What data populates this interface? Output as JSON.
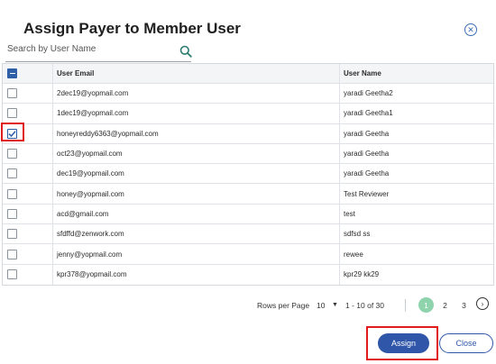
{
  "dialog": {
    "title": "Assign Payer to Member User",
    "close_icon": "close-circle-icon"
  },
  "search": {
    "placeholder": "Search by User Name",
    "icon": "search-icon"
  },
  "table": {
    "columns": [
      "User Email",
      "User Name"
    ],
    "rows": [
      {
        "email": "2dec19@yopmail.com",
        "name": "yaradi Geetha2",
        "checked": false
      },
      {
        "email": "1dec19@yopmail.com",
        "name": "yaradi Geetha1",
        "checked": false
      },
      {
        "email": "honeyreddy6363@yopmail.com",
        "name": "yaradi Geetha",
        "checked": true
      },
      {
        "email": "oct23@yopmail.com",
        "name": "yaradi Geetha",
        "checked": false
      },
      {
        "email": "dec19@yopmail.com",
        "name": "yaradi Geetha",
        "checked": false
      },
      {
        "email": "honey@yopmail.com",
        "name": "Test Reviewer",
        "checked": false
      },
      {
        "email": "acd@gmail.com",
        "name": "test",
        "checked": false
      },
      {
        "email": "sfdffd@zenwork.com",
        "name": "sdfsd ss",
        "checked": false
      },
      {
        "email": "jenny@yopmail.com",
        "name": "rewee",
        "checked": false
      },
      {
        "email": "kpr378@yopmail.com",
        "name": "kpr29 kk29",
        "checked": false
      }
    ]
  },
  "pagination": {
    "rows_per_page_label": "Rows per Page",
    "rows_per_page_value": "10",
    "range": "1 - 10 of 30",
    "pages": [
      "1",
      "2",
      "3"
    ],
    "active_page": "1"
  },
  "actions": {
    "assign_label": "Assign",
    "close_label": "Close"
  },
  "colors": {
    "primary": "#2f56a8",
    "highlight": "#e11b1b",
    "active_page": "#8fd3ad"
  }
}
